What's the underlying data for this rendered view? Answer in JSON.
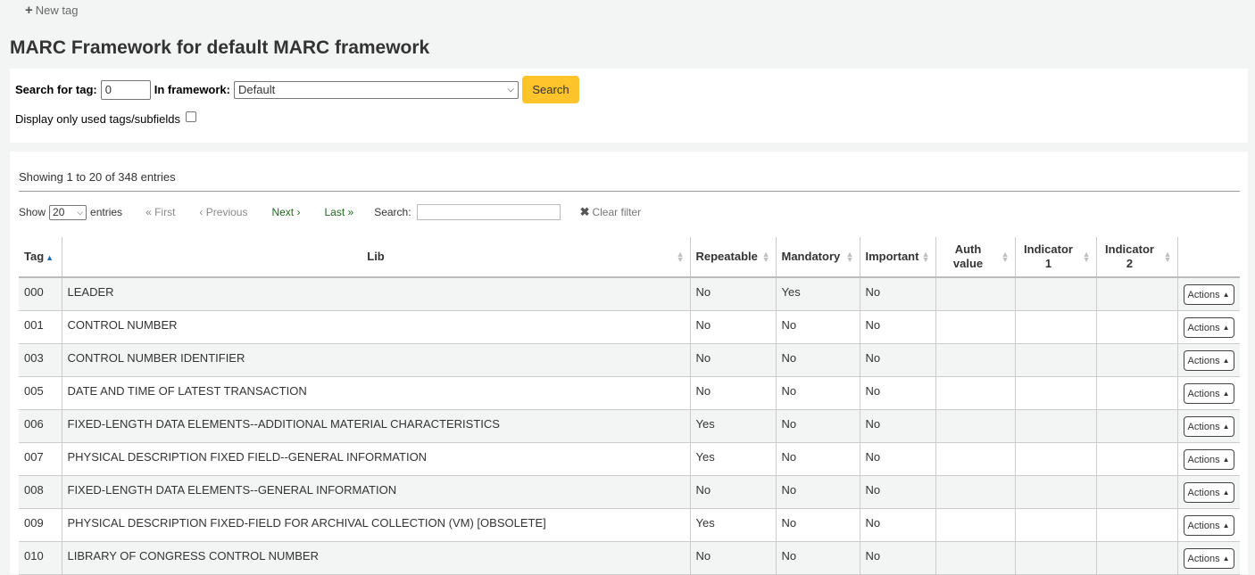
{
  "toolbar": {
    "new_tag_label": "New tag"
  },
  "page_title": "MARC Framework for default MARC framework",
  "search_form": {
    "tag_label": "Search for tag:",
    "tag_value": "0",
    "framework_label": "In framework:",
    "framework_selected": "Default",
    "search_button": "Search",
    "used_only_label": "Display only used tags/subfields",
    "used_only_checked": false
  },
  "table_info": {
    "showing": "Showing 1 to 20 of 348 entries",
    "show_label": "Show",
    "page_length": "20",
    "entries_label": "entries",
    "first": "First",
    "previous": "Previous",
    "next": "Next",
    "last": "Last",
    "search_label": "Search:",
    "search_value": "",
    "clear_filter": "Clear filter"
  },
  "columns": {
    "tag": "Tag",
    "lib": "Lib",
    "repeatable": "Repeatable",
    "mandatory": "Mandatory",
    "important": "Important",
    "auth_value_1": "Auth",
    "auth_value_2": "value",
    "indicator1_1": "Indicator",
    "indicator1_2": "1",
    "indicator2_1": "Indicator",
    "indicator2_2": "2"
  },
  "rows": [
    {
      "tag": "000",
      "lib": "LEADER",
      "repeatable": "No",
      "mandatory": "Yes",
      "important": "No",
      "auth_value": "",
      "indicator1": "",
      "indicator2": "",
      "actions": "Actions"
    },
    {
      "tag": "001",
      "lib": "CONTROL NUMBER",
      "repeatable": "No",
      "mandatory": "No",
      "important": "No",
      "auth_value": "",
      "indicator1": "",
      "indicator2": "",
      "actions": "Actions"
    },
    {
      "tag": "003",
      "lib": "CONTROL NUMBER IDENTIFIER",
      "repeatable": "No",
      "mandatory": "No",
      "important": "No",
      "auth_value": "",
      "indicator1": "",
      "indicator2": "",
      "actions": "Actions"
    },
    {
      "tag": "005",
      "lib": "DATE AND TIME OF LATEST TRANSACTION",
      "repeatable": "No",
      "mandatory": "No",
      "important": "No",
      "auth_value": "",
      "indicator1": "",
      "indicator2": "",
      "actions": "Actions"
    },
    {
      "tag": "006",
      "lib": "FIXED-LENGTH DATA ELEMENTS--ADDITIONAL MATERIAL CHARACTERISTICS",
      "repeatable": "Yes",
      "mandatory": "No",
      "important": "No",
      "auth_value": "",
      "indicator1": "",
      "indicator2": "",
      "actions": "Actions"
    },
    {
      "tag": "007",
      "lib": "PHYSICAL DESCRIPTION FIXED FIELD--GENERAL INFORMATION",
      "repeatable": "Yes",
      "mandatory": "No",
      "important": "No",
      "auth_value": "",
      "indicator1": "",
      "indicator2": "",
      "actions": "Actions"
    },
    {
      "tag": "008",
      "lib": "FIXED-LENGTH DATA ELEMENTS--GENERAL INFORMATION",
      "repeatable": "No",
      "mandatory": "No",
      "important": "No",
      "auth_value": "",
      "indicator1": "",
      "indicator2": "",
      "actions": "Actions"
    },
    {
      "tag": "009",
      "lib": "PHYSICAL DESCRIPTION FIXED-FIELD FOR ARCHIVAL COLLECTION (VM) [OBSOLETE]",
      "repeatable": "Yes",
      "mandatory": "No",
      "important": "No",
      "auth_value": "",
      "indicator1": "",
      "indicator2": "",
      "actions": "Actions"
    },
    {
      "tag": "010",
      "lib": "LIBRARY OF CONGRESS CONTROL NUMBER",
      "repeatable": "No",
      "mandatory": "No",
      "important": "No",
      "auth_value": "",
      "indicator1": "",
      "indicator2": "",
      "actions": "Actions"
    }
  ],
  "colors": {
    "search_button": "#ffc32b",
    "active_link": "#1e6c1e",
    "sort_active": "#1b6bc5"
  }
}
